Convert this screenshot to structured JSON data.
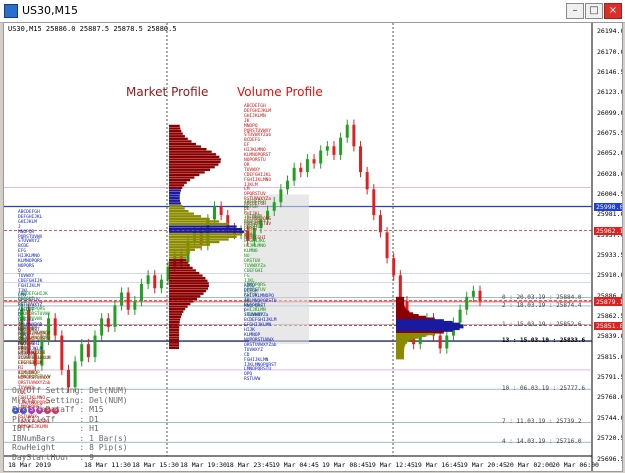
{
  "window": {
    "title": "US30,M15",
    "buttons": {
      "minimize": "–",
      "maximize": "□",
      "close": "×"
    }
  },
  "symbol_line": "US30,M15  25886.0 25887.5 25878.5 25880.5",
  "annotations": {
    "market_profile": "Market Profile",
    "volume_profile": "Volume Profile"
  },
  "price_axis": [
    {
      "label": "26194.0",
      "price": 26194.0
    },
    {
      "label": "26170.0",
      "price": 26170.0
    },
    {
      "label": "26146.5",
      "price": 26146.5
    },
    {
      "label": "26123.0",
      "price": 26123.0
    },
    {
      "label": "26099.0",
      "price": 26099.0
    },
    {
      "label": "26075.5",
      "price": 26075.5
    },
    {
      "label": "26052.0",
      "price": 26052.0
    },
    {
      "label": "26028.0",
      "price": 26028.0
    },
    {
      "label": "26004.5",
      "price": 26004.5
    },
    {
      "label": "25981.0",
      "price": 25981.0
    },
    {
      "label": "25957.0",
      "price": 25957.0
    },
    {
      "label": "25933.5",
      "price": 25933.5
    },
    {
      "label": "25910.0",
      "price": 25910.0
    },
    {
      "label": "25886.0",
      "price": 25886.0
    },
    {
      "label": "25862.5",
      "price": 25862.5
    },
    {
      "label": "25839.0",
      "price": 25839.0
    },
    {
      "label": "25815.0",
      "price": 25815.0
    },
    {
      "label": "25791.5",
      "price": 25791.5
    },
    {
      "label": "25768.0",
      "price": 25768.0
    },
    {
      "label": "25744.0",
      "price": 25744.0
    },
    {
      "label": "25720.5",
      "price": 25720.5
    },
    {
      "label": "25696.5",
      "price": 25696.5
    }
  ],
  "price_tags": [
    {
      "label": "25990.0",
      "color": "#2040d0",
      "price": 25990.0
    },
    {
      "label": "25962.1",
      "color": "#e02020",
      "price": 25962.1
    },
    {
      "label": "25880.5",
      "color": "#e02020",
      "price": 25880.5
    },
    {
      "label": "25879.1",
      "color": "#e02020",
      "price": 25879.1
    },
    {
      "label": "25851.6",
      "color": "#e02020",
      "price": 25851.6
    }
  ],
  "time_axis": [
    "18 Mar 2019",
    "18 Mar 11:30",
    "18 Mar 15:30",
    "18 Mar 19:30",
    "18 Mar 23:45",
    "19 Mar 04:45",
    "19 Mar 08:45",
    "19 Mar 12:45",
    "19 Mar 16:45",
    "19 Mar 20:45",
    "20 Mar 02:00",
    "20 Mar 06:00"
  ],
  "level_labels": [
    {
      "text": "0 : 20.03.19 : 25884.0",
      "price": 25884.0,
      "bold": false
    },
    {
      "text": "2 : 18.03.19 : 25874.4",
      "price": 25874.4,
      "bold": false
    },
    {
      "text": "1 : 15.03.19 : 25852.6",
      "price": 25852.6,
      "bold": false
    },
    {
      "text": "13 : 15.03.19 : 25833.6",
      "price": 25833.6,
      "bold": true
    },
    {
      "text": "10 : 06.03.19 : 25777.6",
      "price": 25777.6,
      "bold": false
    },
    {
      "text": "7 : 11.03.19 : 25739.2",
      "price": 25739.2,
      "bold": false
    },
    {
      "text": "4 : 14.03.19 : 25716.0",
      "price": 25716.0,
      "bold": false
    }
  ],
  "settings": [
    "On/Off Setting: Del(NUM)",
    "Mrkrs  Setting: Del(NUM)",
    "ProfileDataTf : M15",
    "ProfileTf     : D1",
    "IBTf          : H1",
    "IBNumBars     : 1 Bar(s)",
    "RowHeight     : 8 Pip(s)",
    "DayStartHour  : 9"
  ],
  "marker_dots": [
    {
      "label": "1",
      "color": "#3060e0"
    },
    {
      "label": "2",
      "color": "#3060e0"
    },
    {
      "label": "3",
      "color": "#c030c0"
    },
    {
      "label": "4",
      "color": "#c030c0"
    },
    {
      "label": "5",
      "color": "#e03060"
    },
    {
      "label": "6",
      "color": "#e03060"
    }
  ],
  "colors": {
    "bull": "#22a022",
    "bear": "#e02020",
    "profile_dark": "#8b0000",
    "profile_value": "#1a1aa0",
    "profile_olive": "#8b8b00",
    "tpo_blue": "#1020c0",
    "tpo_green": "#109010",
    "tpo_red": "#d01010"
  }
}
